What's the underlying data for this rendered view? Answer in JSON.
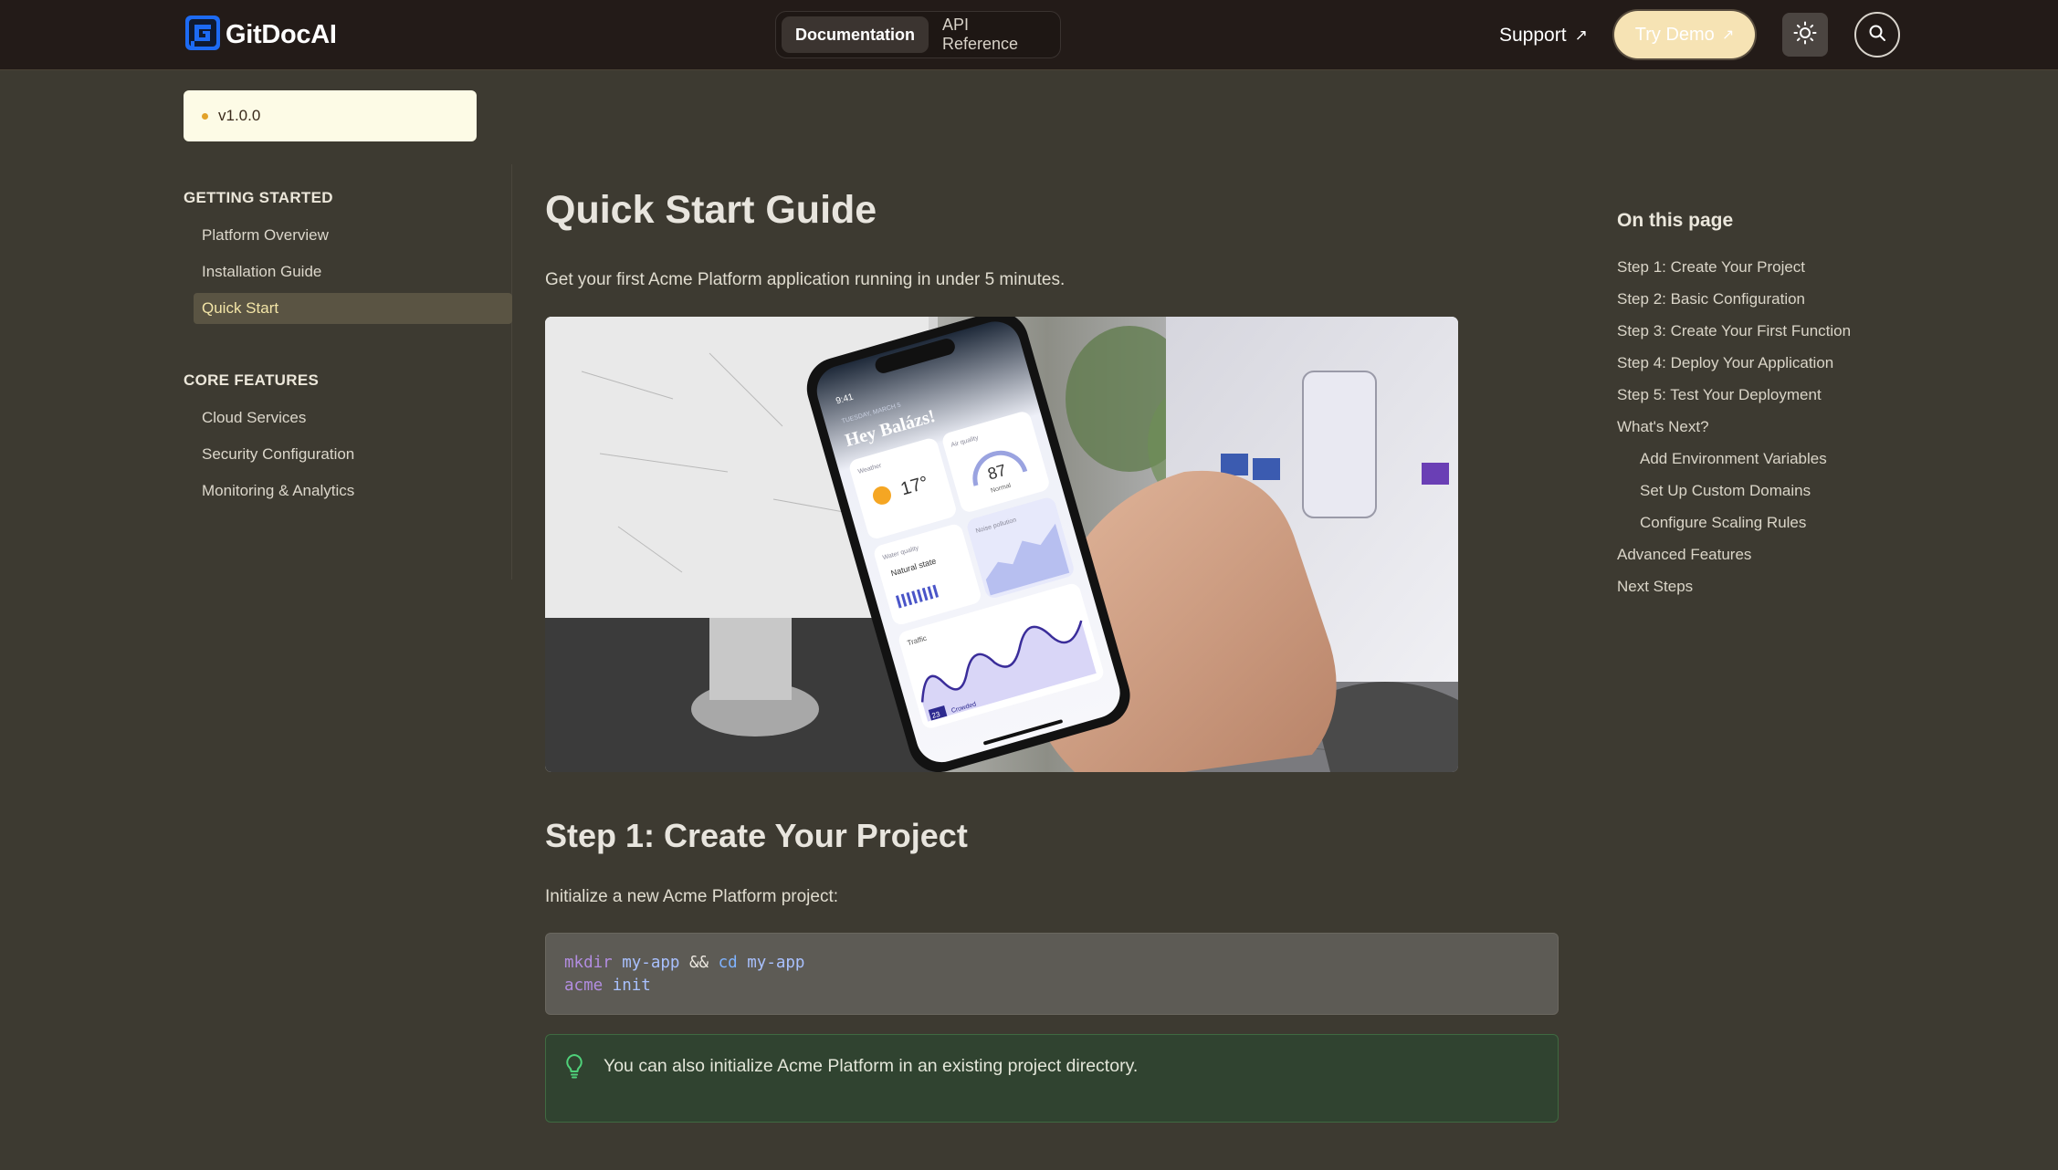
{
  "header": {
    "logo_text": "GitDocAI",
    "tabs": [
      {
        "label": "Documentation",
        "active": true
      },
      {
        "label": "API Reference",
        "active": false
      }
    ],
    "support_label": "Support",
    "try_demo_label": "Try Demo",
    "arrow_glyph": "↗",
    "icons": [
      "logo-icon",
      "sun-icon",
      "search-icon",
      "external-link-icon"
    ]
  },
  "sidebar": {
    "version": "v1.0.0",
    "sections": [
      {
        "title": "GETTING STARTED",
        "items": [
          {
            "label": "Platform Overview",
            "active": false
          },
          {
            "label": "Installation Guide",
            "active": false
          },
          {
            "label": "Quick Start",
            "active": true
          }
        ]
      },
      {
        "title": "CORE FEATURES",
        "items": [
          {
            "label": "Cloud Services",
            "active": false
          },
          {
            "label": "Security Configuration",
            "active": false
          },
          {
            "label": "Monitoring & Analytics",
            "active": false
          }
        ]
      }
    ]
  },
  "main": {
    "title": "Quick Start Guide",
    "lead": "Get your first Acme Platform application running in under 5 minutes.",
    "hero_image": {
      "phone": {
        "time": "9:41",
        "date": "TUESDAY, MARCH 5",
        "greeting": "Hey Balázs!",
        "weather_label": "Weather",
        "temperature": "17°",
        "air_quality_label": "Air quality",
        "air_quality_value": "87",
        "air_quality_status": "Normal",
        "water_quality_label": "Water quality",
        "water_quality_status": "Natural state",
        "noise_label": "Noise pollution",
        "traffic_label": "Traffic",
        "traffic_value": "23",
        "traffic_status": "Crowded"
      }
    },
    "step1": {
      "heading": "Step 1: Create Your Project",
      "intro": "Initialize a new Acme Platform project:",
      "code": {
        "line1": {
          "cmd": "mkdir",
          "arg1": "my-app",
          "op": "&&",
          "fn": "cd",
          "arg2": "my-app"
        },
        "line2": {
          "cmd": "acme",
          "arg": "init"
        }
      },
      "tip": "You can also initialize Acme Platform in an existing project directory."
    }
  },
  "toc": {
    "title": "On this page",
    "items": [
      {
        "label": "Step 1: Create Your Project",
        "level": 1
      },
      {
        "label": "Step 2: Basic Configuration",
        "level": 1
      },
      {
        "label": "Step 3: Create Your First Function",
        "level": 1
      },
      {
        "label": "Step 4: Deploy Your Application",
        "level": 1
      },
      {
        "label": "Step 5: Test Your Deployment",
        "level": 1
      },
      {
        "label": "What's Next?",
        "level": 1
      },
      {
        "label": "Add Environment Variables",
        "level": 2
      },
      {
        "label": "Set Up Custom Domains",
        "level": 2
      },
      {
        "label": "Configure Scaling Rules",
        "level": 2
      },
      {
        "label": "Advanced Features",
        "level": 1
      },
      {
        "label": "Next Steps",
        "level": 1
      }
    ]
  },
  "colors": {
    "background": "#3d3a31",
    "header": "#231b18",
    "accent": "#f6e3b4",
    "active_nav": "#f3e5a7",
    "tip_bg": "#304330"
  }
}
